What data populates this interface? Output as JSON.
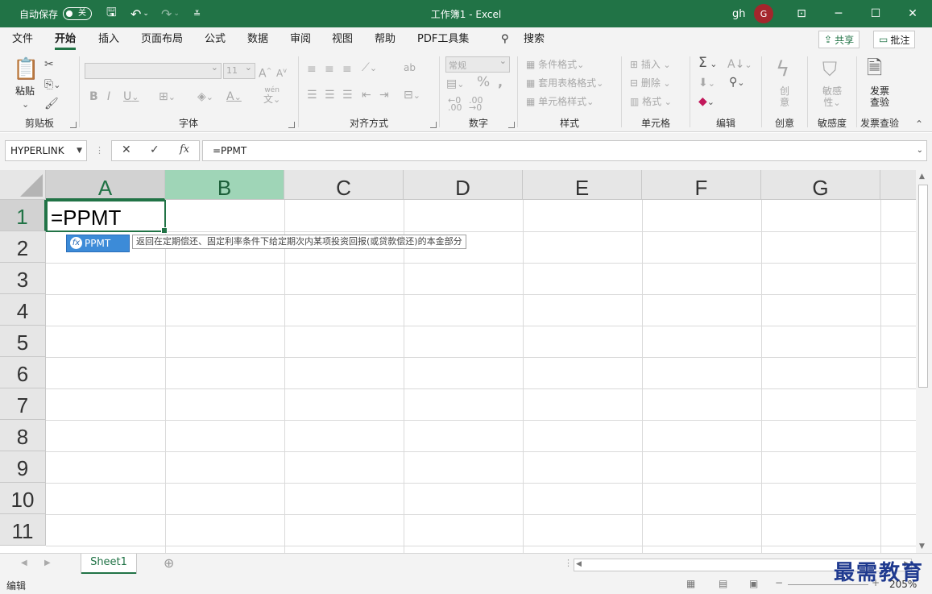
{
  "titlebar": {
    "autosave_label": "自动保存",
    "autosave_state": "关",
    "doc_title": "工作簿1  -  Excel",
    "user": "gh",
    "avatar_initial": "G"
  },
  "tabs": [
    "文件",
    "开始",
    "插入",
    "页面布局",
    "公式",
    "数据",
    "审阅",
    "视图",
    "帮助",
    "PDF工具集"
  ],
  "search_label": "搜索",
  "share_label": "共享",
  "comment_label": "批注",
  "ribbon": {
    "clipboard": {
      "paste": "粘贴",
      "label": "剪贴板"
    },
    "font": {
      "font_size": "11",
      "label": "字体",
      "wen": "wén",
      "wen_char": "文"
    },
    "alignment": {
      "label": "对齐方式",
      "wrap": "ab"
    },
    "number": {
      "format": "常规",
      "label": "数字"
    },
    "styles": {
      "conditional": "条件格式",
      "table": "套用表格格式",
      "cell_styles": "单元格样式",
      "label": "样式"
    },
    "cells": {
      "insert": "插入",
      "delete": "删除",
      "format": "格式",
      "label": "单元格"
    },
    "editing": {
      "label": "编辑"
    },
    "ideas": {
      "top": "创",
      "bottom": "意",
      "label": "创意"
    },
    "sensitivity": {
      "top": "敏感",
      "bottom": "性",
      "label": "敏感度"
    },
    "invoice": {
      "top": "发票",
      "bottom": "查验",
      "label": "发票查验"
    }
  },
  "formula_bar": {
    "name_box": "HYPERLINK",
    "fx": "fx",
    "formula": "=PPMT"
  },
  "grid": {
    "columns": [
      "A",
      "B",
      "C",
      "D",
      "E",
      "F",
      "G"
    ],
    "rows": [
      "1",
      "2",
      "3",
      "4",
      "5",
      "6",
      "7",
      "8",
      "9",
      "10",
      "11"
    ],
    "active_cell_text": "=PPMT"
  },
  "autocomplete": {
    "item": "PPMT",
    "icon": "fx",
    "tooltip": "返回在定期偿还、固定利率条件下给定期次内某项投资回报(或贷款偿还)的本金部分"
  },
  "sheets": [
    "Sheet1"
  ],
  "status": {
    "mode": "编辑",
    "zoom": "205%"
  },
  "watermark": "最需教育",
  "colors": {
    "accent": "#217346",
    "autocomplete": "#3c8bd8",
    "selected_col": "#9fd5b7"
  }
}
